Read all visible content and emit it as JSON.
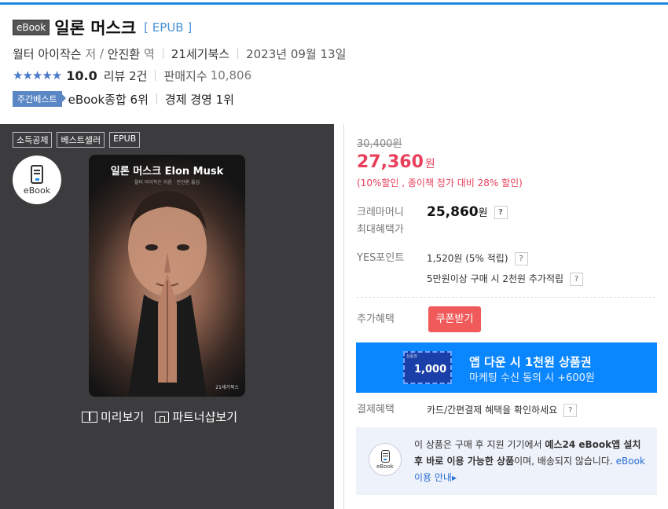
{
  "header": {
    "badge": "eBook",
    "title": "일론 머스크",
    "format": "[ EPUB ]",
    "author": "월터 아이작슨",
    "author_role": "저",
    "translator": "안진환",
    "translator_role": "역",
    "publisher": "21세기북스",
    "date": "2023년 09월 13일",
    "stars": "★★★★★",
    "score": "10.0",
    "review": "리뷰 2건",
    "sales_label": "판매지수",
    "sales_num": "10,806",
    "weekly_badge": "주간베스트",
    "rank1": "eBook종합 6위",
    "rank2": "경제 경영 1위"
  },
  "left": {
    "tags": [
      "소득공제",
      "베스트셀러",
      "EPUB"
    ],
    "ebook_label": "eBook",
    "cover_title": "일론 머스크 Elon Musk",
    "cover_sub": "월터 아이작슨 지음 · 안진환 옮김",
    "cover_pub": "21세기북스",
    "preview": "미리보기",
    "partner": "파트너샵보기"
  },
  "price": {
    "original": "30,400원",
    "sale": "27,360",
    "sale_unit": "원",
    "discount": "(10%할인 , 종이책 정가 대비 28% 할인)",
    "cm_label1": "크레마머니",
    "cm_label2": "최대혜택가",
    "cm_value": "25,860",
    "cm_unit": "원",
    "yes_label": "YES포인트",
    "yes_value": "1,520원 (5% 적립)",
    "yes_extra": "5만원이상 구매 시 2천원 추가적립",
    "extra_label": "추가혜택",
    "coupon": "쿠폰받기",
    "voucher_small": "상품권",
    "voucher_amt": "1,000",
    "banner_main": "앱 다운 시 1천원 상품권",
    "banner_sub": "마케팅 수신 동의 시 +600원",
    "pay_label": "결제혜택",
    "pay_value": "카드/간편결제 혜택을 확인하세요",
    "help": "?"
  },
  "info": {
    "ebook_label": "eBook",
    "t1": "이 상품은 구매 후 지원 기기에서 ",
    "t2": "예스24 eBook앱 설치 후 바로 이용 가능한 상품",
    "t3": "이며, 배송되지 않습니다. ",
    "link": "eBook 이용 안내▸"
  }
}
